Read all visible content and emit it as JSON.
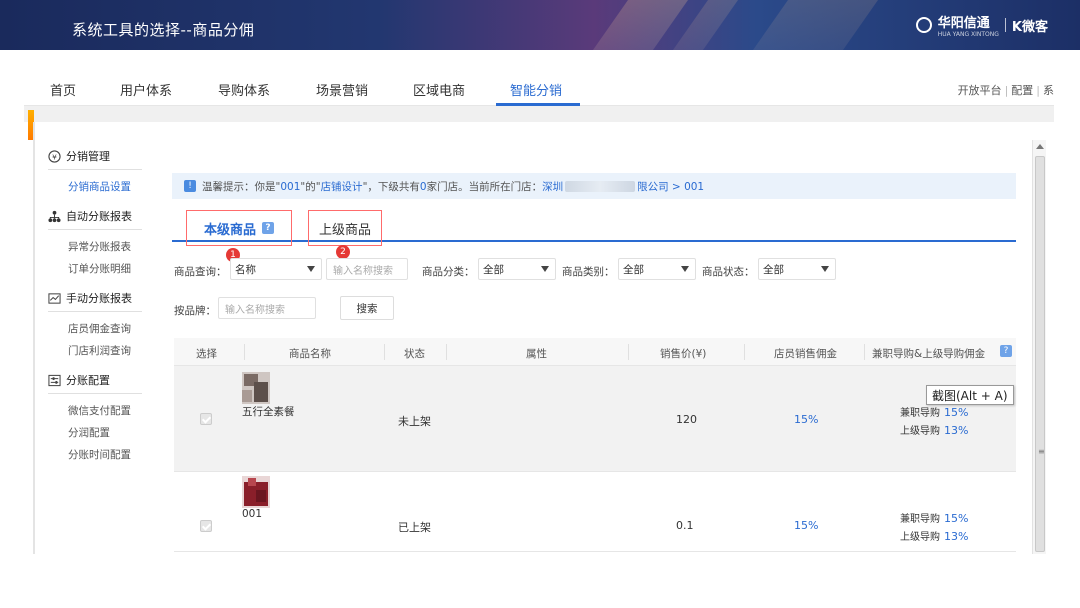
{
  "banner": {
    "title": "系统工具的选择--商品分佣",
    "brand_name": "华阳信通",
    "brand_sub": "HUA YANG XINTONG",
    "brand2": "K微客"
  },
  "topnav": {
    "items": [
      "首页",
      "用户体系",
      "导购体系",
      "场景营销",
      "区域电商",
      "智能分销"
    ],
    "active_index": 5,
    "links": [
      "开放平台",
      "配置",
      "系"
    ]
  },
  "sidebar": {
    "groups": [
      {
        "icon": "money-circle-icon",
        "title": "分销管理",
        "items": [
          "分销商品设置"
        ]
      },
      {
        "icon": "org-tree-icon",
        "title": "自动分账报表",
        "items": [
          "异常分账报表",
          "订单分账明细"
        ]
      },
      {
        "icon": "chart-line-icon",
        "title": "手动分账报表",
        "items": [
          "店员佣金查询",
          "门店利润查询"
        ]
      },
      {
        "icon": "sliders-icon",
        "title": "分账配置",
        "items": [
          "微信支付配置",
          "分润配置",
          "分账时间配置"
        ]
      }
    ],
    "active_item": "分销商品设置"
  },
  "notice": {
    "prefix": "温馨提示：你是\"",
    "code": "001",
    "mid1": "\"的\"",
    "role": "店铺设计",
    "mid2": "\"，下级共有",
    "count": "0",
    "mid3": "家门店。当前所在门店：",
    "store_start": "深圳",
    "store_end": "限公司 > 001"
  },
  "tabs": {
    "tab1": "本级商品",
    "tab2": "上级商品",
    "marker1": "1",
    "marker2": "2"
  },
  "filters": {
    "query_label": "商品查询：",
    "query_select": "名称",
    "query_placeholder": "输入名称搜索",
    "category_label": "商品分类：",
    "category_value": "全部",
    "type_label": "商品类别：",
    "type_value": "全部",
    "status_label": "商品状态：",
    "status_value": "全部",
    "brand_label": "按品牌：",
    "brand_placeholder": "输入名称搜索",
    "search_button": "搜索"
  },
  "table": {
    "headers": [
      "选择",
      "商品名称",
      "状态",
      "属性",
      "销售价(¥)",
      "店员销售佣金",
      "兼职导购&上级导购佣金"
    ],
    "rows": [
      {
        "name": "五行全素餐",
        "status": "未上架",
        "price": "120",
        "staff_commission": "15%",
        "part_time_label": "兼职导购",
        "part_time": "15%",
        "upper_label": "上级导购",
        "upper": "13%",
        "thumb_color": "#6b5a55"
      },
      {
        "name": "001",
        "status": "已上架",
        "price": "0.1",
        "staff_commission": "15%",
        "part_time_label": "兼职导购",
        "part_time": "15%",
        "upper_label": "上级导购",
        "upper": "13%",
        "thumb_color": "#8a1f2a"
      }
    ]
  },
  "tooltip": "截图(Alt + A)",
  "colors": {
    "accent": "#2a6bd1",
    "marker": "#e53935",
    "tab_outline": "#ff6b6b"
  }
}
